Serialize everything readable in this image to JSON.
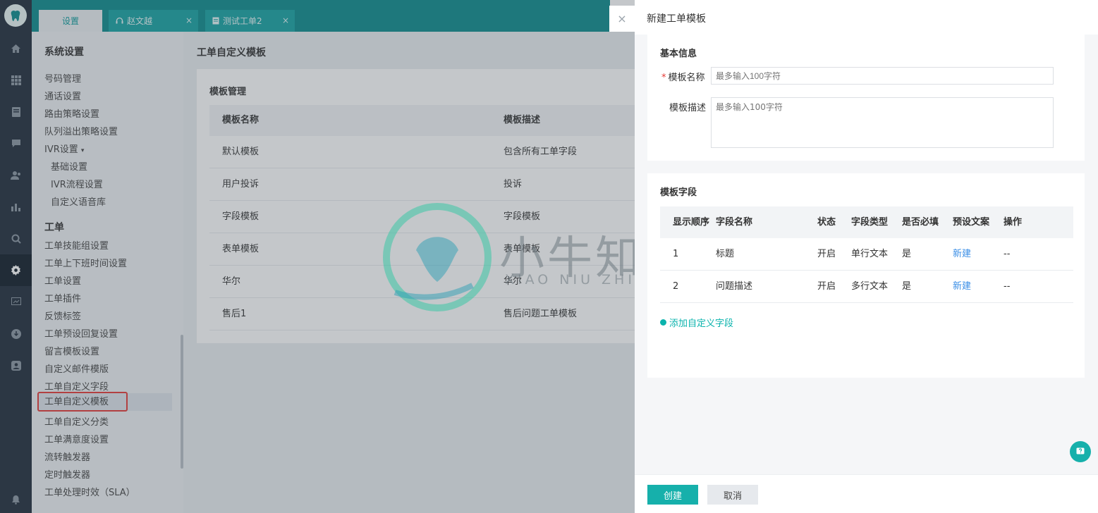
{
  "tabs": [
    {
      "label": "设置"
    },
    {
      "label": "赵文越",
      "close": "×"
    },
    {
      "label": "测试工单2",
      "close": "×"
    }
  ],
  "menu": {
    "section_system": "系统设置",
    "system_items": [
      "号码管理",
      "通话设置",
      "路由策略设置",
      "队列溢出策略设置",
      "IVR设置"
    ],
    "ivr_sub_items": [
      "基础设置",
      "IVR流程设置",
      "自定义语音库"
    ],
    "section_ticket": "工单",
    "ticket_items": [
      "工单技能组设置",
      "工单上下班时间设置",
      "工单设置",
      "工单插件",
      "反馈标签",
      "工单预设回复设置",
      "留言模板设置",
      "自定义邮件模版",
      "工单自定义字段",
      "工单自定义模板",
      "工单自定义分类",
      "工单满意度设置",
      "流转触发器",
      "定时触发器",
      "工单处理时效（SLA）"
    ],
    "selected_item": "工单自定义模板"
  },
  "content": {
    "title": "工单自定义模板",
    "panel_title": "模板管理",
    "columns": [
      "模板名称",
      "模板描述"
    ],
    "rows": [
      [
        "默认模板",
        "包含所有工单字段"
      ],
      [
        "用户投诉",
        "投诉"
      ],
      [
        "字段模板",
        "字段模板"
      ],
      [
        "表单模板",
        "表单模板"
      ],
      [
        "华尔",
        "华尔"
      ],
      [
        "售后1",
        "售后问题工单模板"
      ]
    ]
  },
  "watermark": {
    "title": "小牛知识库",
    "subtitle": "XIAO NIU ZHI SHI KU"
  },
  "drawer": {
    "close": "×",
    "title": "新建工单模板",
    "basic_info": {
      "title": "基本信息",
      "name_label": "模板名称",
      "name_required": "*",
      "name_placeholder": "最多输入100字符",
      "desc_label": "模板描述",
      "desc_placeholder": "最多输入100字符"
    },
    "fields": {
      "title": "模板字段",
      "columns": [
        "显示顺序",
        "字段名称",
        "状态",
        "字段类型",
        "是否必填",
        "预设文案",
        "操作"
      ],
      "rows": [
        [
          "1",
          "标题",
          "开启",
          "单行文本",
          "是",
          "新建",
          "--"
        ],
        [
          "2",
          "问题描述",
          "开启",
          "多行文本",
          "是",
          "新建",
          "--"
        ]
      ],
      "add_label": "添加自定义字段"
    },
    "create_button": "创建",
    "cancel_button": "取消"
  },
  "colors": {
    "accent": "#16b0ab",
    "topbar": "#0b8b8c",
    "rail": "#1f2b3a",
    "link": "#3a8ee6",
    "highlight": "#e53935"
  }
}
